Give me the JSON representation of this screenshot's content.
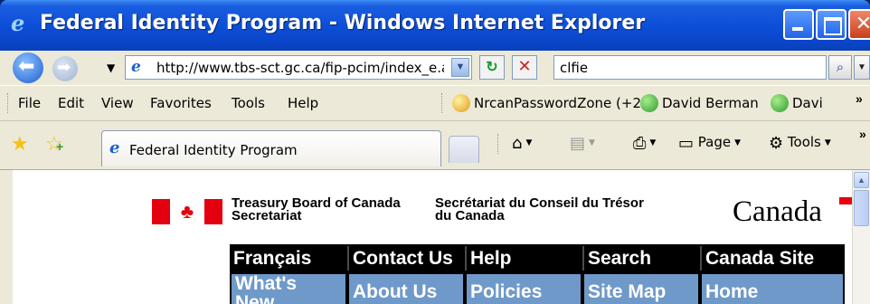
{
  "window": {
    "title": "Federal Identity Program - Windows Internet Explorer",
    "icon": "ie-logo-icon"
  },
  "addressbar": {
    "url": "http://www.tbs-sct.gc.ca/fip-pcim/index_e.a",
    "search_value": "clfie"
  },
  "menu": {
    "items": [
      "File",
      "Edit",
      "View",
      "Favorites",
      "Tools",
      "Help"
    ]
  },
  "links": {
    "items": [
      "NrcanPasswordZone (+2)",
      "David Berman",
      "Davi"
    ]
  },
  "tabs": {
    "active_label": "Federal Identity Program"
  },
  "commandbar": {
    "page_label": "Page",
    "tools_label": "Tools"
  },
  "page": {
    "dept_en_line1": "Treasury Board of Canada",
    "dept_en_line2": "Secretariat",
    "dept_fr_line1": "Secrétariat du Conseil du Trésor",
    "dept_fr_line2": "du Canada",
    "wordmark": "Canada",
    "nav_top": [
      "Français",
      "Contact Us",
      "Help",
      "Search",
      "Canada Site"
    ],
    "nav_bottom": [
      "What's",
      "New",
      "About Us",
      "Policies",
      "Site Map",
      "Home"
    ]
  },
  "colors": {
    "titlebar": "#0d4fd8",
    "nav_blue": "#6f99c9",
    "flag_red": "#e3000f"
  }
}
